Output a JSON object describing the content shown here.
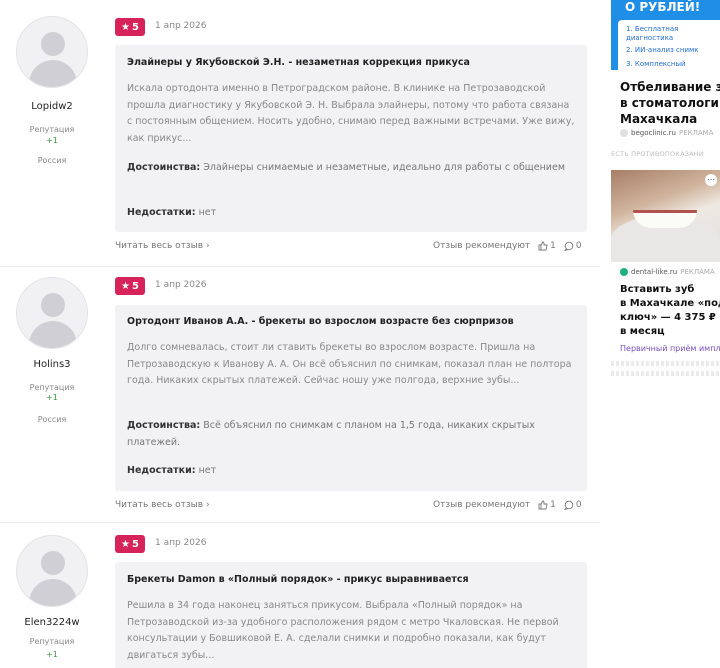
{
  "reviews": [
    {
      "user": "Lopidw2",
      "rep_label": "Репутация",
      "rep_value": "+1",
      "country": "Россия",
      "rating": "5",
      "date": "1 апр 2026",
      "title": "Элайнеры у Якубовской Э.Н. - незаметная коррекция прикуса",
      "text": "Искала ортодонта именно в Петроградском районе. В клинике на Петрозаводской прошла диагностику у Якубовской Э. Н. Выбрала элайнеры, потому что работа связана с постоянным общением. Носить удобно, снимаю перед важными встречами. Уже вижу, как прикус...",
      "pros_label": "Достоинства:",
      "pros": "Элайнеры снимаемые и незаметные, идеально для работы с общением",
      "cons_label": "Недостатки:",
      "cons": "нет",
      "read_more": "Читать весь отзыв",
      "recommend": "Отзыв рекомендуют",
      "likes": "1",
      "comments": "0"
    },
    {
      "user": "Holins3",
      "rep_label": "Репутация",
      "rep_value": "+1",
      "country": "Россия",
      "rating": "5",
      "date": "1 апр 2026",
      "title": "Ортодонт Иванов А.А. - брекеты во взрослом возрасте без сюрпризов",
      "text": "Долго сомневалась, стоит ли ставить брекеты во взрослом возрасте. Пришла на Петрозаводскую к Иванову А. А. Он всё объяснил по снимкам, показал план не полтора года. Никаких скрытых платежей. Сейчас ношу уже полгода, верхние зубы...",
      "pros_label": "Достоинства:",
      "pros": "Всё объяснил по снимкам с планом на 1,5 года, никаких скрытых платежей.",
      "cons_label": "Недостатки:",
      "cons": "нет",
      "read_more": "Читать весь отзыв",
      "recommend": "Отзыв рекомендуют",
      "likes": "1",
      "comments": "0"
    },
    {
      "user": "Elen3224w",
      "rep_label": "Репутация",
      "rep_value": "+1",
      "rating": "5",
      "date": "1 апр 2026",
      "title": "Брекеты Damon в «Полный порядок» - прикус выравнивается",
      "text": "Решила в 34 года наконец заняться прикусом. Выбрала «Полный порядок» на Петрозаводской из-за удобного расположения рядом с метро Чкаловская. Не первой консультации у Бовшиковой Е. А. сделали снимки и подробно показали, как будут двигаться зубы..."
    }
  ],
  "ad": {
    "banner_title": "О РУБЛЕЙ!",
    "banner_lines": [
      "1. Бесплатная",
      "диагностика",
      "2. ИИ-анализ снимк",
      "3. Комплексный"
    ],
    "ad1_headline": [
      "Отбеливание зу",
      "в стоматологи",
      "Махачкала"
    ],
    "ad1_source": "begoclinic.ru",
    "ad1_source_tag": "РЕКЛАМА",
    "warning": "ЕСТЬ ПРОТИВОПОКАЗАНИ",
    "ad2_source": "dental-like.ru",
    "ad2_source_tag": "РЕКЛАМА",
    "ad2_headline": [
      "Вставить зуб",
      "в Махачкале «под",
      "ключ» — 4 375 ₽",
      "в месяц"
    ],
    "ad2_cta": "Первичный приём импла",
    "colors": {
      "banner": "#1f8ee6",
      "badge": "#d6245a",
      "cta": "#7a4fc0",
      "rep": "#3a9a3a"
    }
  }
}
